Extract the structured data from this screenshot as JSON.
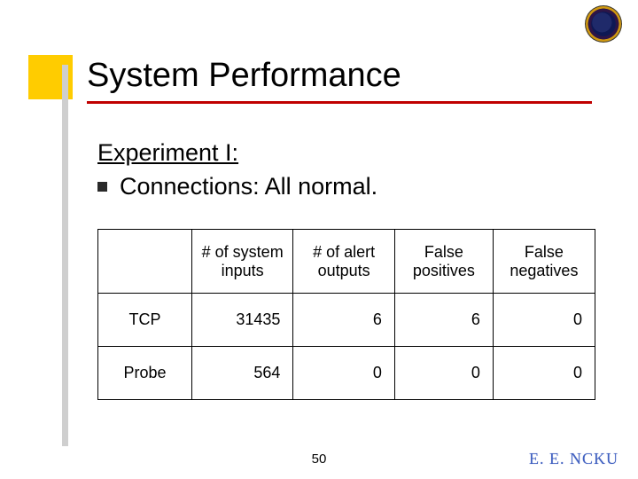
{
  "title": "System Performance",
  "subtitle": "Experiment I:",
  "bullet_text": "Connections: All normal.",
  "table": {
    "headers": {
      "c1": "# of system inputs",
      "c2": "# of alert outputs",
      "c3": "False positives",
      "c4": "False negatives"
    },
    "rows": [
      {
        "label": "TCP",
        "inputs": "31435",
        "alerts": "6",
        "fp": "6",
        "fn": "0"
      },
      {
        "label": "Probe",
        "inputs": "564",
        "alerts": "0",
        "fp": "0",
        "fn": "0"
      }
    ]
  },
  "page_number": "50",
  "footer_brand": "E. E. NCKU",
  "chart_data": {
    "type": "table",
    "columns": [
      "",
      "# of system inputs",
      "# of alert outputs",
      "False positives",
      "False negatives"
    ],
    "rows": [
      [
        "TCP",
        31435,
        6,
        6,
        0
      ],
      [
        "Probe",
        564,
        0,
        0,
        0
      ]
    ],
    "title": "System Performance — Experiment I: Connections: All normal."
  }
}
